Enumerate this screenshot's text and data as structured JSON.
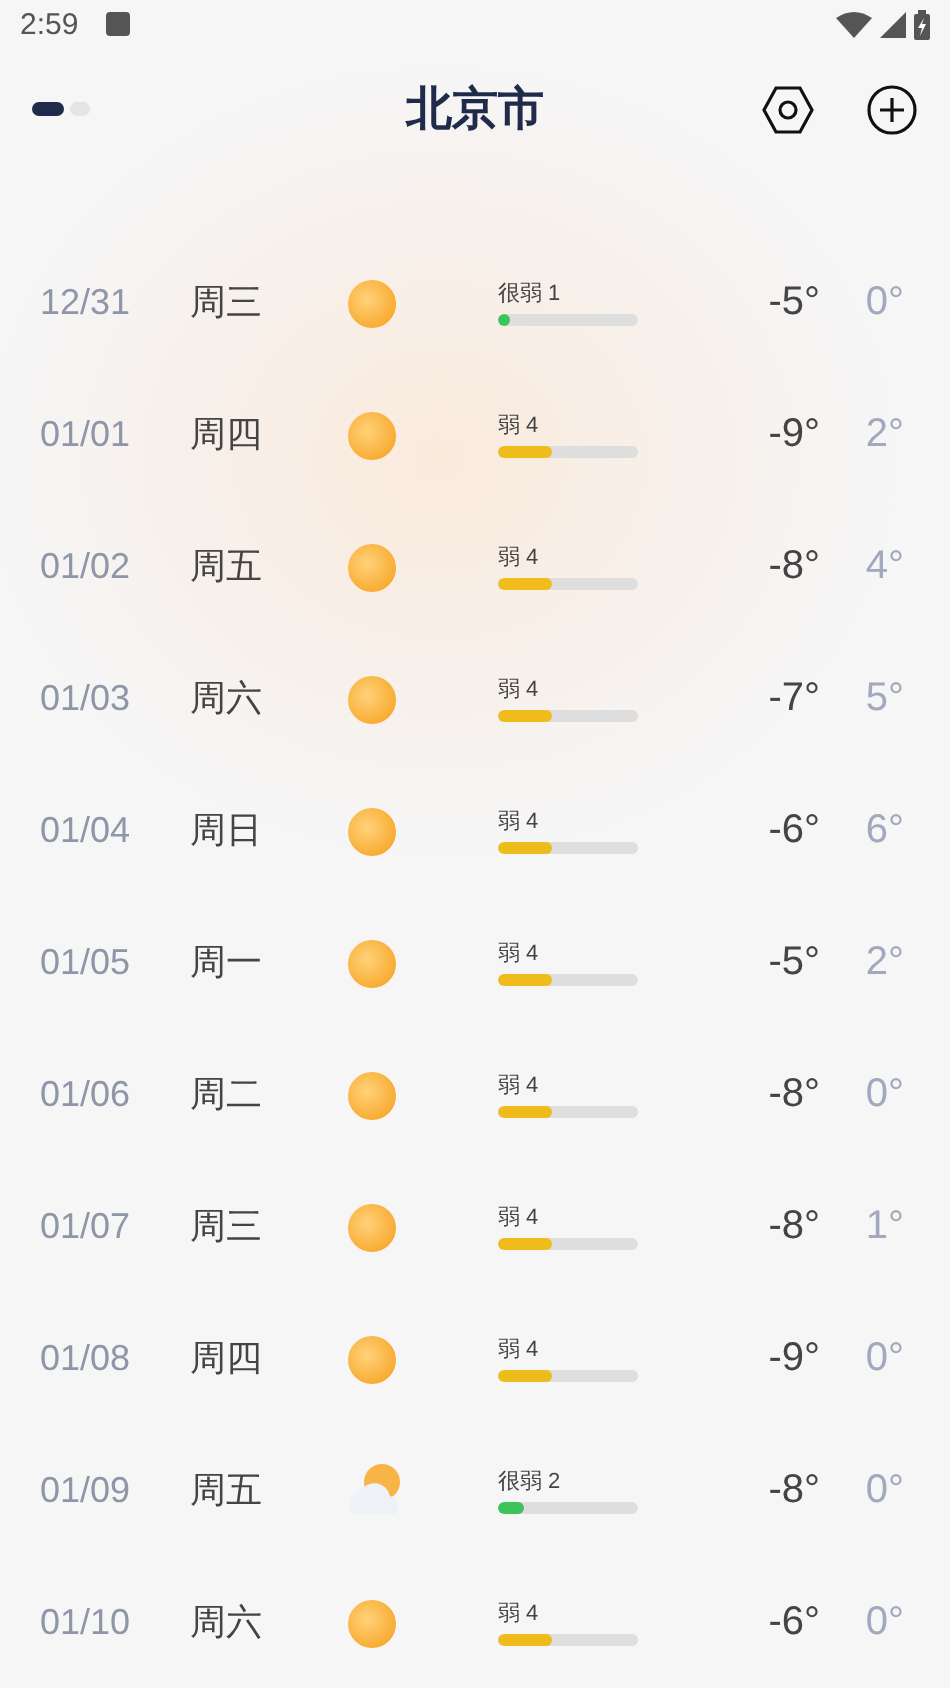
{
  "status_bar": {
    "time": "2:59"
  },
  "header": {
    "title": "北京市",
    "pages": [
      {
        "selected": true
      },
      {
        "selected": false
      }
    ]
  },
  "days": [
    {
      "date": "12/31",
      "weekday": "周三",
      "kind": "sun",
      "aqi": {
        "label": "很弱 1",
        "level": 0.05,
        "color": "#3cc35a"
      },
      "temp_1": "-5°",
      "temp_2": "0°"
    },
    {
      "date": "01/01",
      "weekday": "周四",
      "kind": "sun",
      "aqi": {
        "label": "弱 4",
        "level": 0.38,
        "color": "#f0bc1c"
      },
      "temp_1": "-9°",
      "temp_2": "2°"
    },
    {
      "date": "01/02",
      "weekday": "周五",
      "kind": "sun",
      "aqi": {
        "label": "弱 4",
        "level": 0.38,
        "color": "#f0bc1c"
      },
      "temp_1": "-8°",
      "temp_2": "4°"
    },
    {
      "date": "01/03",
      "weekday": "周六",
      "kind": "sun",
      "aqi": {
        "label": "弱 4",
        "level": 0.38,
        "color": "#f0bc1c"
      },
      "temp_1": "-7°",
      "temp_2": "5°"
    },
    {
      "date": "01/04",
      "weekday": "周日",
      "kind": "sun",
      "aqi": {
        "label": "弱 4",
        "level": 0.38,
        "color": "#f0bc1c"
      },
      "temp_1": "-6°",
      "temp_2": "6°"
    },
    {
      "date": "01/05",
      "weekday": "周一",
      "kind": "sun",
      "aqi": {
        "label": "弱 4",
        "level": 0.38,
        "color": "#f0bc1c"
      },
      "temp_1": "-5°",
      "temp_2": "2°"
    },
    {
      "date": "01/06",
      "weekday": "周二",
      "kind": "sun",
      "aqi": {
        "label": "弱 4",
        "level": 0.38,
        "color": "#f0bc1c"
      },
      "temp_1": "-8°",
      "temp_2": "0°"
    },
    {
      "date": "01/07",
      "weekday": "周三",
      "kind": "sun",
      "aqi": {
        "label": "弱 4",
        "level": 0.38,
        "color": "#f0bc1c"
      },
      "temp_1": "-8°",
      "temp_2": "1°"
    },
    {
      "date": "01/08",
      "weekday": "周四",
      "kind": "sun",
      "aqi": {
        "label": "弱 4",
        "level": 0.38,
        "color": "#f0bc1c"
      },
      "temp_1": "-9°",
      "temp_2": "0°"
    },
    {
      "date": "01/09",
      "weekday": "周五",
      "kind": "cloudy",
      "aqi": {
        "label": "很弱 2",
        "level": 0.18,
        "color": "#3cc35a"
      },
      "temp_1": "-8°",
      "temp_2": "0°"
    },
    {
      "date": "01/10",
      "weekday": "周六",
      "kind": "sun",
      "aqi": {
        "label": "弱 4",
        "level": 0.38,
        "color": "#f0bc1c"
      },
      "temp_1": "-6°",
      "temp_2": "0°"
    }
  ]
}
